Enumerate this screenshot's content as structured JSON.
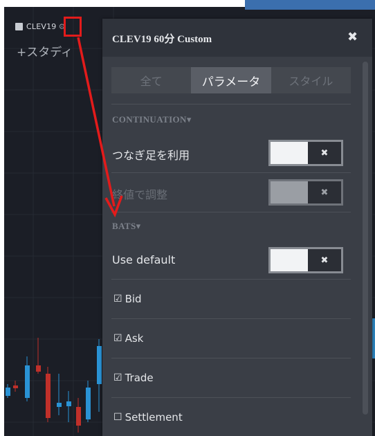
{
  "chart": {
    "symbol": "CLEV19",
    "study_label": "+スタディ",
    "colors": {
      "background": "#1b1e26",
      "up": "#2a93d5",
      "down": "#c0302a"
    }
  },
  "panel": {
    "title": "CLEV19 60分 Custom",
    "tabs": [
      {
        "label": "全て"
      },
      {
        "label": "パラメータ"
      },
      {
        "label": "スタイル"
      }
    ],
    "active_tab": "パラメータ",
    "continuation": {
      "title": "CONTINUATION▾",
      "use_continuous": {
        "label": "つなぎ足を利用",
        "toggle": "✖",
        "on": false
      },
      "adjust_close": {
        "label": "終値で調整",
        "toggle": "✖",
        "on": false,
        "disabled": true
      }
    },
    "bats": {
      "title": "BATS▾",
      "use_default": {
        "label": "Use default",
        "toggle": "✖",
        "on": false
      },
      "checkboxes": [
        {
          "label": "Bid",
          "checked": true
        },
        {
          "label": "Ask",
          "checked": true
        },
        {
          "label": "Trade",
          "checked": true
        },
        {
          "label": "Settlement",
          "checked": false
        }
      ]
    }
  }
}
